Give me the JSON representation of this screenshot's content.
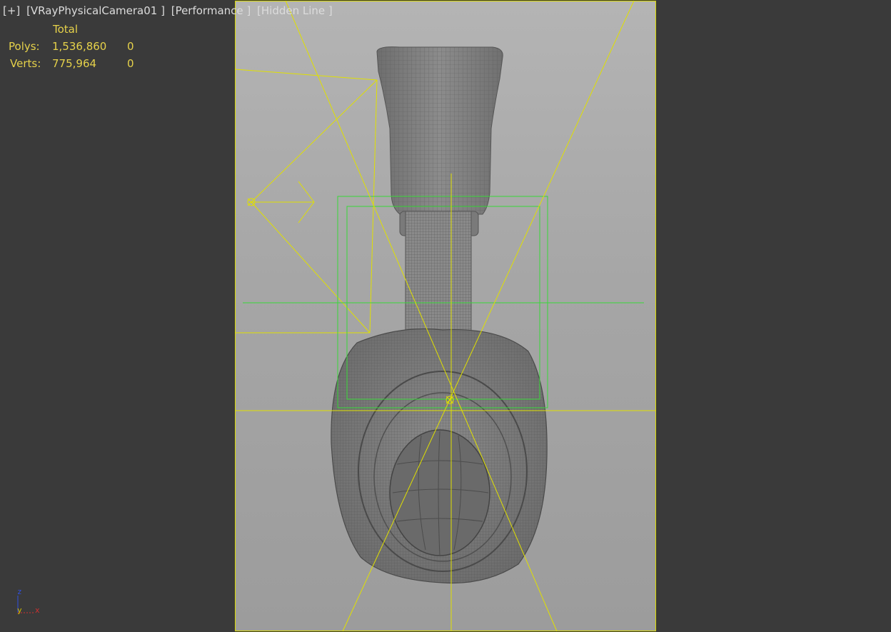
{
  "viewport_label": {
    "plus_menu": "[+]",
    "camera": "[VRayPhysicalCamera01 ]",
    "mode": "[Performance ]",
    "shading": "[Hidden Line ]"
  },
  "stats": {
    "header": "Total",
    "rows": [
      {
        "label": "Polys:",
        "total": "1,536,860",
        "selected": "0"
      },
      {
        "label": "Verts:",
        "total": "775,964",
        "selected": "0"
      }
    ]
  },
  "axis_gizmo": {
    "z": "z",
    "y": "y",
    "x": "x"
  },
  "colors": {
    "viewport_bg": "#3a3a3a",
    "safe_frame": "#d8d800",
    "camera_lines": "#e0e000",
    "selection_box": "#38d838",
    "stats_text": "#e6d24a",
    "axis_x": "#d03030",
    "axis_y": "#d0c000",
    "axis_z": "#3050e0"
  }
}
